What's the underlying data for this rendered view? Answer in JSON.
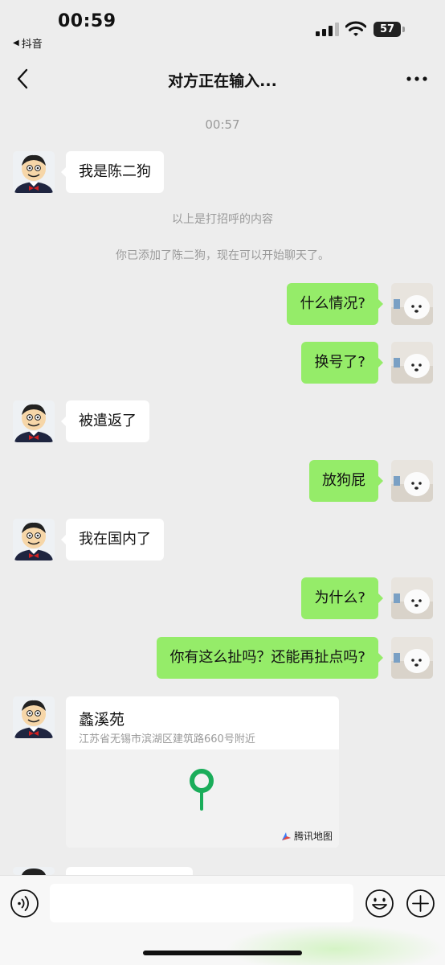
{
  "status_bar": {
    "time": "00:59",
    "back_app": "抖音",
    "battery": "57"
  },
  "nav": {
    "title": "对方正在输入..."
  },
  "chat": {
    "timestamp": "00:57",
    "system_greeting": "以上是打招呼的内容",
    "system_added": "你已添加了陈二狗，现在可以开始聊天了。",
    "messages": [
      {
        "from": "contact",
        "text": "我是陈二狗"
      },
      {
        "from": "me",
        "text": "什么情况?"
      },
      {
        "from": "me",
        "text": "换号了?"
      },
      {
        "from": "contact",
        "text": "被遣返了"
      },
      {
        "from": "me",
        "text": "放狗屁"
      },
      {
        "from": "contact",
        "text": "我在国内了"
      },
      {
        "from": "me",
        "text": "为什么?"
      },
      {
        "from": "me",
        "text": "你有这么扯吗？还能再扯点吗?"
      }
    ],
    "location": {
      "name": "蠡溪苑",
      "address": "江苏省无锡市滨湖区建筑路660号附近",
      "brand": "腾讯地图"
    }
  },
  "input_bar": {
    "placeholder": ""
  },
  "colors": {
    "background": "#ededed",
    "outgoing_bubble": "#95ec69",
    "incoming_bubble": "#ffffff",
    "map_pin": "#1aad5a"
  }
}
